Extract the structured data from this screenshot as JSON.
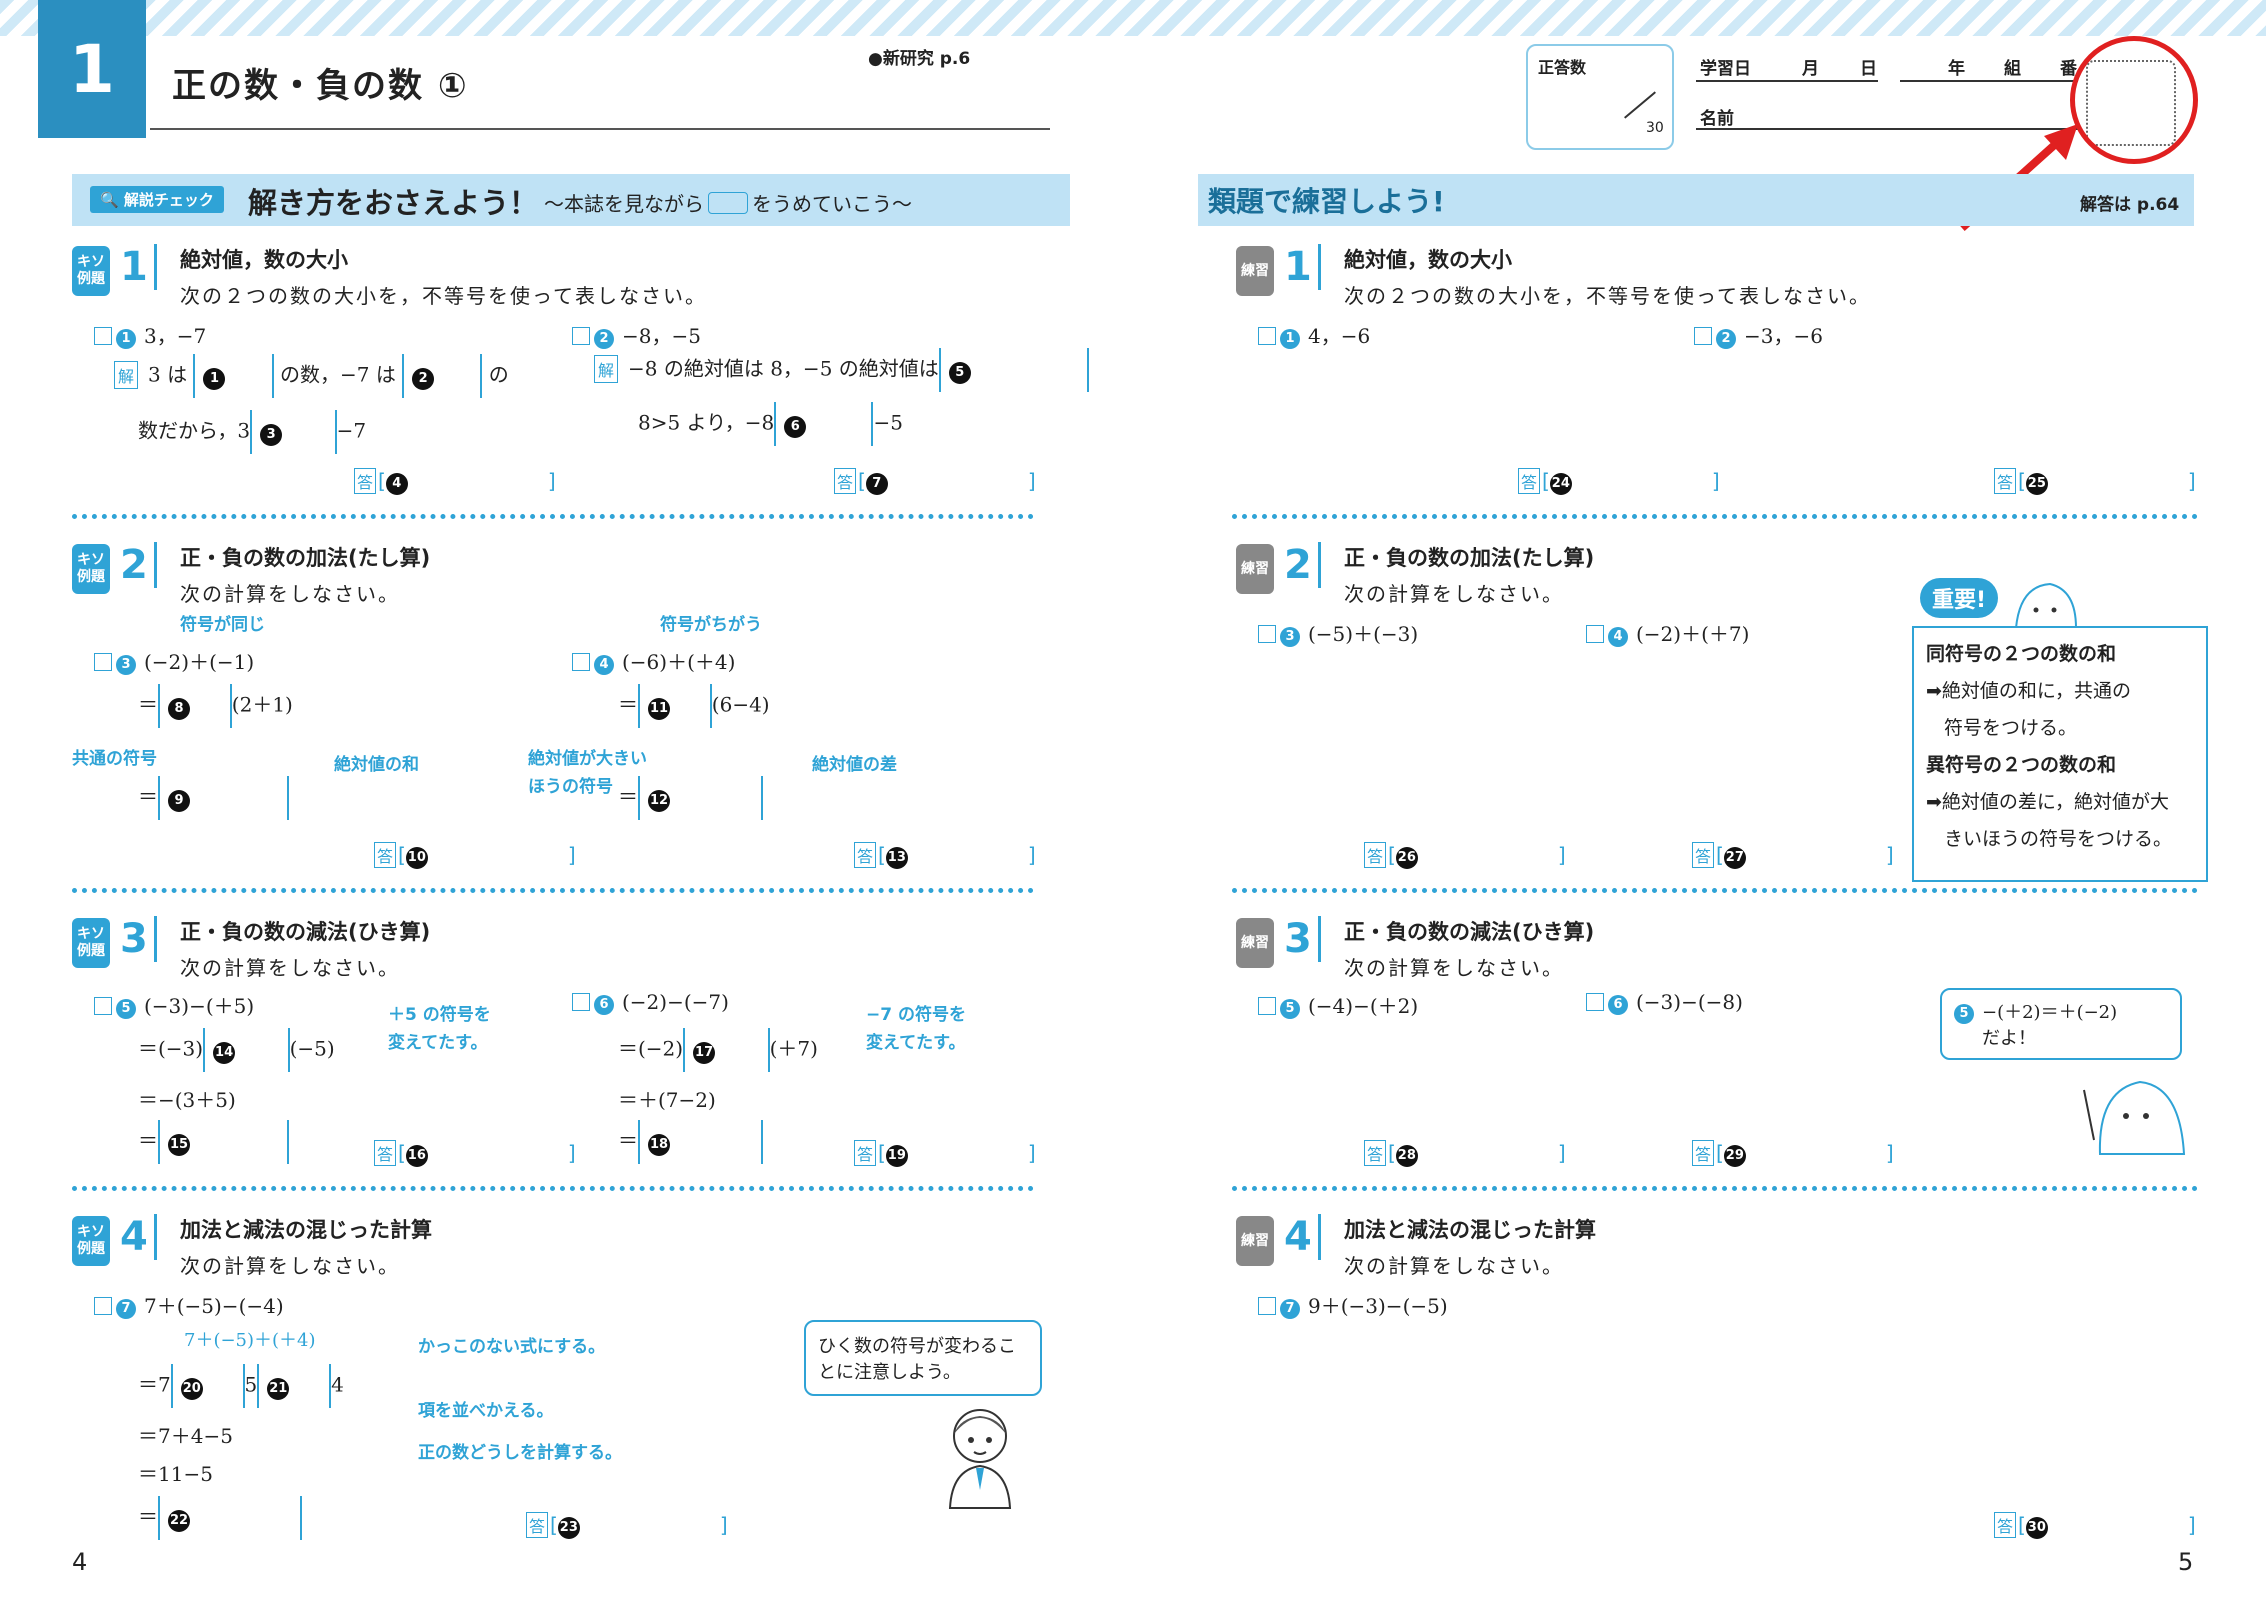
{
  "header": {
    "chapter_number": "1",
    "chapter_title": "正の数・負の数 ①",
    "reference": "●新研究 p.6",
    "score_label": "正答数",
    "score_total": "30",
    "study_date_label": "学習日",
    "month": "月",
    "day": "日",
    "year": "年",
    "class": "組",
    "number": "番",
    "name_label": "名前"
  },
  "left": {
    "bar_tag": "解説チェック",
    "bar_title": "解き方をおさえよう！",
    "bar_subtitle": "〜本誌を見ながら",
    "bar_subtitle_end": "をうめていこう〜",
    "badge_line1": "キソ",
    "badge_line2": "例題",
    "ans_tag": "答",
    "kai_tag": "解",
    "s1": {
      "num": "1",
      "title": "絶対値，数の大小",
      "sub": "次の２つの数の大小を，不等号を使って表しなさい。",
      "p1": "3，−7",
      "p2": "−8，−5",
      "p1a": "3 は",
      "p1b": "の数，−7 は",
      "p1c": "の",
      "p1d": "数だから，3",
      "p1e": "−7",
      "p2a": "−8 の絶対値は 8，−5 の絶対値は",
      "p2b": "8>5 より，−8",
      "p2c": "−5"
    },
    "s2": {
      "num": "2",
      "title": "正・負の数の加法(たし算)",
      "sub": "次の計算をしなさい。",
      "p3": "(−2)＋(−1)",
      "p4": "(−6)＋(＋4)",
      "lab_same": "符号が同じ",
      "lab_diff": "符号がちがう",
      "p3b": "(2＋1)",
      "p4b": "(6−4)",
      "lab_common": "共通の符号",
      "lab_sum": "絶対値の和",
      "lab_bigger1": "絶対値が大きい",
      "lab_bigger2": "ほうの符号",
      "lab_diffabs": "絶対値の差"
    },
    "s3": {
      "num": "3",
      "title": "正・負の数の減法(ひき算)",
      "sub": "次の計算をしなさい。",
      "p5": "(−3)−(＋5)",
      "p6": "(−2)−(−7)",
      "p5a": "＝(−3)",
      "p5b": "(−5)",
      "p5c": "＝−(3＋5)",
      "p6a": "＝(−2)",
      "p6b": "(＋7)",
      "p6c": "＝＋(7−2)",
      "note5a": "＋5 の符号を",
      "note5b": "変えてたす。",
      "note6a": "−7 の符号を",
      "note6b": "変えてたす。"
    },
    "s4": {
      "num": "4",
      "title": "加法と減法の混じった計算",
      "sub": "次の計算をしなさい。",
      "p7": "7＋(−5)−(−4)",
      "p7sub": "7＋(−5)＋(＋4)",
      "l1": "＝7",
      "l1b": "5",
      "l1c": "4",
      "l2": "＝7＋4−5",
      "l3": "＝11−5",
      "l4": "＝",
      "n1": "かっこのない式にする。",
      "n2": "項を並べかえる。",
      "n3": "正の数どうしを計算する。",
      "speech": "ひく数の符号が変わることに注意しよう。"
    }
  },
  "right": {
    "bar_title": "類題で練習しよう!",
    "answer_ref": "解答は p.64",
    "badge": "練習",
    "s1": {
      "num": "1",
      "title": "絶対値，数の大小",
      "sub": "次の２つの数の大小を，不等号を使って表しなさい。",
      "p1": "4，−6",
      "p2": "−3，−6"
    },
    "s2": {
      "num": "2",
      "title": "正・負の数の加法(たし算)",
      "sub": "次の計算をしなさい。",
      "p3": "(−5)＋(−3)",
      "p4": "(−2)＋(＋7)"
    },
    "s3": {
      "num": "3",
      "title": "正・負の数の減法(ひき算)",
      "sub": "次の計算をしなさい。",
      "p5": "(−4)−(＋2)",
      "p6": "(−3)−(−8)",
      "bubble1": "−(＋2)＝＋(−2)",
      "bubble2": "だよ！"
    },
    "s4": {
      "num": "4",
      "title": "加法と減法の混じった計算",
      "sub": "次の計算をしなさい。",
      "p7": "9＋(−3)−(−5)"
    },
    "tip": {
      "badge": "重要!",
      "h1": "同符号の２つの数の和",
      "t1a": "➡絶対値の和に，共通の",
      "t1b": "符号をつける。",
      "h2": "異符号の２つの数の和",
      "t2a": "➡絶対値の差に，絶対値が大",
      "t2b": "きいほうの符号をつける。"
    }
  },
  "pages": {
    "left": "4",
    "right": "5"
  },
  "colors": {
    "accent": "#2fa3d6",
    "bar": "#bfe2f5",
    "highlight": "#e02020"
  }
}
